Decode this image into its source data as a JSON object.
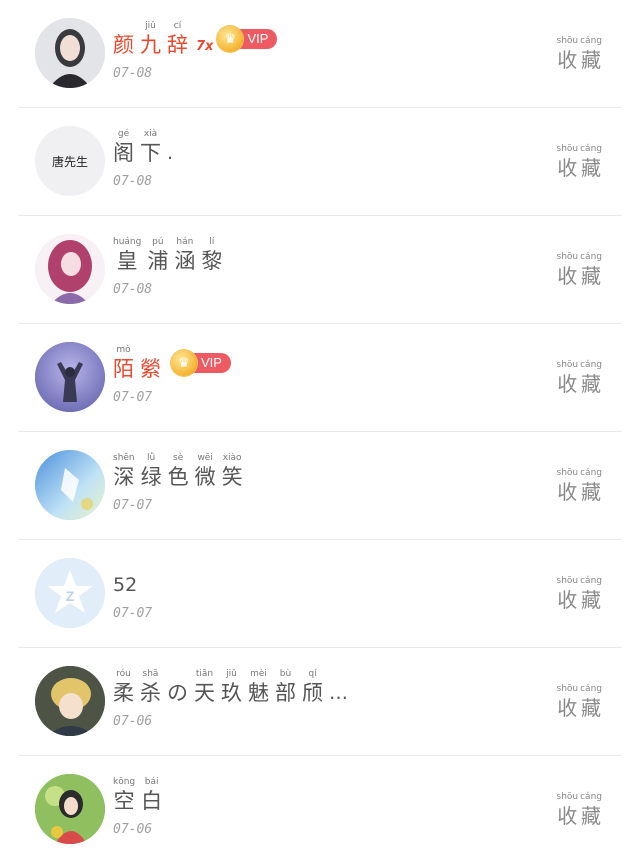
{
  "collect_label": {
    "py1": "shōu",
    "hz1": "收",
    "py2": "cáng",
    "hz2": "藏"
  },
  "rows": [
    {
      "words": [
        {
          "py": "",
          "hz": "颜"
        },
        {
          "py": "jiǔ",
          "hz": "九"
        },
        {
          "py": "cí",
          "hz": "辞"
        }
      ],
      "suffix": "7x",
      "vip": "VIP",
      "date": "07-08"
    },
    {
      "avatar_text": "唐先生",
      "words": [
        {
          "py": "gé",
          "hz": "阁"
        },
        {
          "py": "xià",
          "hz": "下"
        }
      ],
      "trail": ".",
      "date": "07-08"
    },
    {
      "words": [
        {
          "py": "huáng",
          "hz": "皇"
        },
        {
          "py": "pú",
          "hz": "浦"
        },
        {
          "py": "hán",
          "hz": "涵"
        },
        {
          "py": "lí",
          "hz": "黎"
        }
      ],
      "date": "07-08"
    },
    {
      "words": [
        {
          "py": "mò",
          "hz": "陌"
        },
        {
          "py": "",
          "hz": "縈"
        }
      ],
      "vip": "VIP",
      "date": "07-07"
    },
    {
      "words": [
        {
          "py": "shēn",
          "hz": "深"
        },
        {
          "py": "lǜ",
          "hz": "绿"
        },
        {
          "py": "sè",
          "hz": "色"
        },
        {
          "py": "wēi",
          "hz": "微"
        },
        {
          "py": "xiào",
          "hz": "笑"
        }
      ],
      "date": "07-07"
    },
    {
      "plain": "52",
      "date": "07-07"
    },
    {
      "words": [
        {
          "py": "róu",
          "hz": "柔"
        },
        {
          "py": "shā",
          "hz": "杀"
        },
        {
          "py": "",
          "hz": "の"
        },
        {
          "py": "tiān",
          "hz": "天"
        },
        {
          "py": "jiǔ",
          "hz": "玖"
        },
        {
          "py": "mèi",
          "hz": "魅"
        },
        {
          "py": "bù",
          "hz": "部"
        },
        {
          "py": "qí",
          "hz": "颀"
        }
      ],
      "trail": "…",
      "date": "07-06"
    },
    {
      "words": [
        {
          "py": "kōng",
          "hz": "空"
        },
        {
          "py": "bái",
          "hz": "白"
        }
      ],
      "date": "07-06"
    }
  ]
}
